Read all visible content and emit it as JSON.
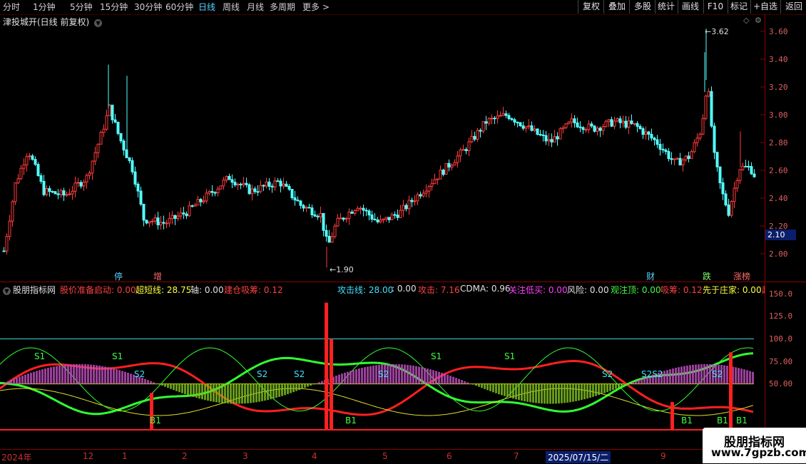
{
  "topbar": {
    "timeframes": [
      "分时",
      "1分钟",
      "5分钟",
      "15分钟",
      "30分钟",
      "60分钟",
      "日线",
      "周线",
      "月线",
      "多周期",
      "更多"
    ],
    "active": "日线",
    "right_buttons": [
      "复权",
      "叠加",
      "多股",
      "统计",
      "画线",
      "F10",
      "标记",
      "+自选",
      "返回"
    ]
  },
  "main_chart": {
    "title": "津投城开(日线 前复权)",
    "y_ticks": [
      "3.60",
      "3.40",
      "3.20",
      "3.00",
      "2.80",
      "2.60",
      "2.40",
      "2.20",
      "2.00"
    ],
    "high_label": "3.62",
    "low_label": "1.90",
    "current_price": "2.10",
    "event_markers": [
      {
        "text": "停",
        "color": "#5ad1ff"
      },
      {
        "text": "增",
        "color": "#ff6a6a"
      },
      {
        "text": "财",
        "color": "#5ad1ff"
      },
      {
        "text": "跌",
        "color": "#7dff6a"
      },
      {
        "text": "涨榜",
        "color": "#ff6a6a"
      }
    ]
  },
  "indicator_panel": {
    "title": "股朋指标网",
    "readouts": [
      {
        "text": "股价准备启动: 0.00",
        "color": "#ff4040"
      },
      {
        "text": "超短线: 28.75",
        "color": "#ffff40"
      },
      {
        "text": "轴: 0.00",
        "color": "#e0e0e0"
      },
      {
        "text": "建仓吸筹: 0.12",
        "color": "#ff4040"
      },
      {
        "text": "攻击线: 28.00",
        "color": "#40e0ff"
      },
      {
        "text": ": 0.00",
        "color": "#e0e0e0"
      },
      {
        "text": "攻击: 7.16",
        "color": "#ff4040"
      },
      {
        "text": "CDMA: 0.96",
        "color": "#e0e0e0"
      },
      {
        "text": "关注低买: 0.00",
        "color": "#ff40ff"
      },
      {
        "text": "风险: 0.00",
        "color": "#e0e0e0"
      },
      {
        "text": "观注顶: 0.00",
        "color": "#40ff40"
      },
      {
        "text": "吸筹: 0.12",
        "color": "#ff4040"
      },
      {
        "text": "先于庄家: 0.00",
        "color": "#ffff40"
      },
      {
        "text": "超",
        "color": "#ff4040"
      }
    ],
    "y_ticks": [
      "150.0",
      "125.0",
      "100.0",
      "75.00",
      "50.00"
    ],
    "signal_labels": [
      "S1",
      "S1",
      "S2",
      "S2",
      "S2",
      "S2",
      "S1",
      "S1",
      "S2",
      "S2S2",
      "S2",
      "B1",
      "B1",
      "B1",
      "B1",
      "B1"
    ]
  },
  "date_axis": [
    "2024年",
    "12",
    "1",
    "2",
    "3",
    "4",
    "5",
    "6",
    "7",
    "2025/07/15/二",
    "9"
  ],
  "watermark": "股朋指标网\nwww.7gpzb.com",
  "watermark_line1": "股朋指标网",
  "watermark_line2": "www.7gpzb.com"
}
